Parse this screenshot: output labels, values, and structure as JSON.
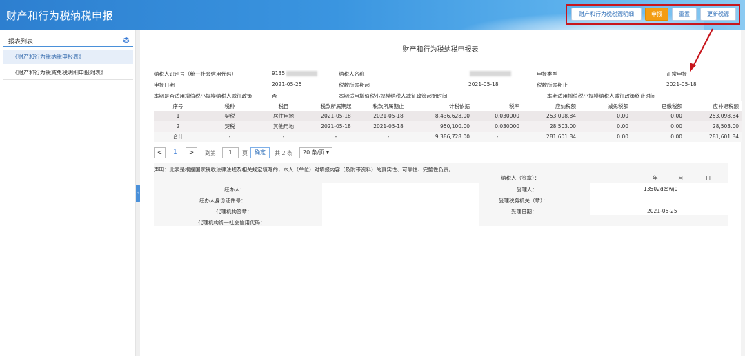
{
  "header": {
    "title": "财产和行为税纳税申报",
    "buttons": {
      "detail": "财产和行为税税源明细",
      "declare": "申报",
      "reset": "重置",
      "update": "更新税源"
    }
  },
  "sidebar": {
    "title": "报表列表",
    "items": [
      {
        "label": "《财产和行为税纳税申报表》"
      },
      {
        "label": "《财产和行为税减免税明细申报附表》"
      }
    ]
  },
  "form": {
    "title": "财产和行为税纳税申报表",
    "info": {
      "taxpayer_id_label": "纳税人识别号（统一社会信用代码）",
      "taxpayer_id_value": "9135",
      "taxpayer_name_label": "纳税人名称",
      "declare_type_label": "申报类型",
      "declare_type_value": "正常申报",
      "declare_date_label": "申报日期",
      "declare_date_value": "2021-05-25",
      "period_start_label": "税款所属期起",
      "period_start_value": "2021-05-18",
      "period_end_label": "税款所属期止",
      "period_end_value": "2021-05-18",
      "small_scale_label": "本期是否适用增值税小规模纳税人减征政策",
      "small_scale_value": "否",
      "small_scale_start_label": "本期适用增值税小规模纳税人减征政策起始时间",
      "small_scale_end_label": "本期适用增值税小规模纳税人减征政策终止时间"
    },
    "table": {
      "headers": [
        "序号",
        "税种",
        "税目",
        "税款所属期起",
        "税款所属期止",
        "计税依据",
        "税率",
        "应纳税额",
        "减免税额",
        "已缴税额",
        "应补退税额"
      ],
      "rows": [
        [
          "1",
          "契税",
          "居住用地",
          "2021-05-18",
          "2021-05-18",
          "8,436,628.00",
          "0.030000",
          "253,098.84",
          "0.00",
          "0.00",
          "253,098.84"
        ],
        [
          "2",
          "契税",
          "其他用地",
          "2021-05-18",
          "2021-05-18",
          "950,100.00",
          "0.030000",
          "28,503.00",
          "0.00",
          "0.00",
          "28,503.00"
        ]
      ],
      "total": [
        "合计",
        "-",
        "-",
        "-",
        "-",
        "9,386,728.00",
        "-",
        "281,601.84",
        "0.00",
        "0.00",
        "281,601.84"
      ]
    },
    "pager": {
      "prev": "<",
      "current_page": "1",
      "next": ">",
      "goto_label": "到第",
      "page_input": "1",
      "page_unit": "页",
      "confirm": "确定",
      "total": "共 2 条",
      "page_size": "20 条/页"
    },
    "declaration": {
      "statement": "声明：此表是根据国家税收法律法规及相关规定填写的，本人（单位）对填报内容（及附带资料）的真实性、可靠性、完整性负责。",
      "taxpayer_sign": "纳税人（签章）：",
      "year": "年",
      "month": "月",
      "day": "日",
      "handler": "经办人：",
      "handler_id": "经办人身份证件号：",
      "agency_sign": "代理机构签章：",
      "agency_code": "代理机构统一社会信用代码：",
      "receiver_label": "受理人：",
      "receiver_value": "13502dzswj0",
      "tax_office_label": "受理税务机关（章）：",
      "receive_date_label": "受理日期：",
      "receive_date_value": "2021-05-25"
    }
  },
  "colors": {
    "header_start": "#2d7fd0",
    "header_end": "#8ccaf2",
    "primary_button": "#f39c12",
    "highlight_border": "#c8161d",
    "link": "#3a7bd5"
  }
}
